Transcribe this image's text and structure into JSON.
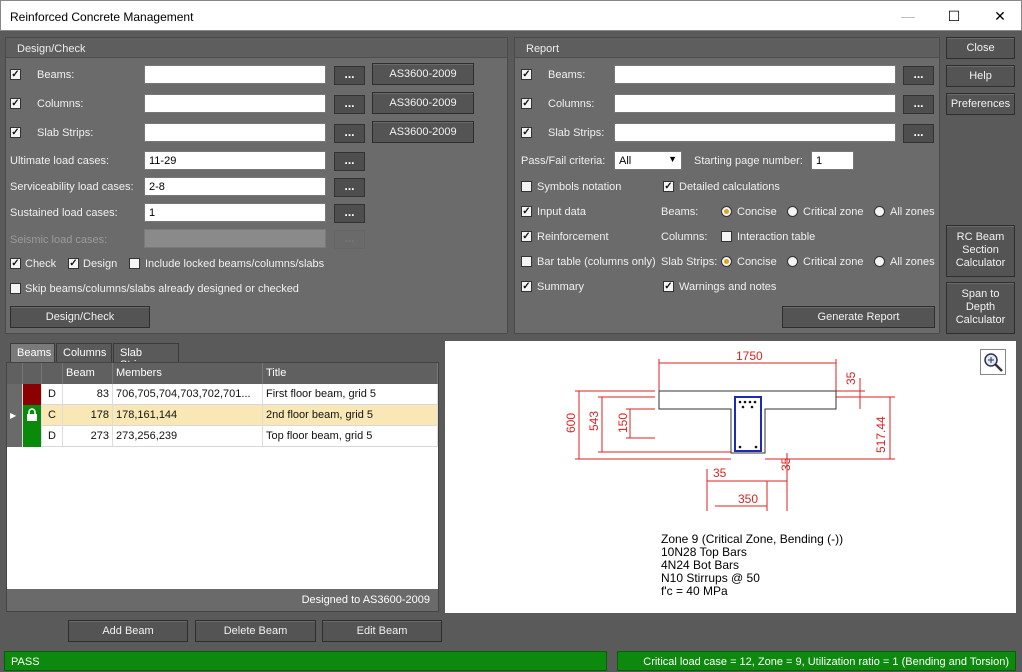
{
  "window": {
    "title": "Reinforced Concrete Management",
    "minimize": "—",
    "maximize": "☐",
    "close": "✕"
  },
  "design": {
    "title": "Design/Check",
    "beams": "Beams:",
    "columns": "Columns:",
    "slabs": "Slab Strips:",
    "code_beams": "AS3600-2009",
    "code_columns": "AS3600-2009",
    "code_slabs": "AS3600-2009",
    "dots": "...",
    "ult_label": "Ultimate load cases:",
    "ult_value": "11-29",
    "svc_label": "Serviceability load cases:",
    "svc_value": "2-8",
    "sus_label": "Sustained load cases:",
    "sus_value": "1",
    "seis_label": "Seismic load cases:",
    "check": "Check",
    "design": "Design",
    "include_locked": "Include locked beams/columns/slabs",
    "skip": "Skip beams/columns/slabs already designed or checked",
    "button": "Design/Check"
  },
  "report": {
    "title": "Report",
    "beams": "Beams:",
    "columns": "Columns:",
    "slabs": "Slab Strips:",
    "passfail_label": "Pass/Fail criteria:",
    "passfail_value": "All",
    "startpage_label": "Starting page number:",
    "startpage_value": "1",
    "symbols": "Symbols notation",
    "detailed": "Detailed calculations",
    "input": "Input data",
    "beams_opt": "Beams:",
    "concise": "Concise",
    "critical": "Critical zone",
    "allzones": "All zones",
    "reinforcement": "Reinforcement",
    "columns_opt": "Columns:",
    "interaction": "Interaction table",
    "bartable": "Bar table (columns only)",
    "slabs_opt": "Slab Strips:",
    "summary": "Summary",
    "warnings": "Warnings and notes",
    "generate": "Generate Report"
  },
  "side": {
    "close": "Close",
    "help": "Help",
    "prefs": "Preferences",
    "rc_calc": [
      "RC Beam",
      "Section",
      "Calculator"
    ],
    "span_calc": [
      "Span to",
      "Depth",
      "Calculator"
    ]
  },
  "tabs": [
    "Beams",
    "Columns",
    "Slab Strips"
  ],
  "table": {
    "headers": [
      "Beam",
      "Members",
      "Title"
    ],
    "rows": [
      {
        "code": "D",
        "beam": "83",
        "members": "706,705,704,703,702,701...",
        "title": "First floor beam, grid 5",
        "color": "#8b0000"
      },
      {
        "code": "C",
        "beam": "178",
        "members": "178,161,144",
        "title": "2nd floor beam, grid 5",
        "color": "#0a8a0a"
      },
      {
        "code": "D",
        "beam": "273",
        "members": "273,256,239",
        "title": "Top floor beam, grid 5",
        "color": "#0a8a0a"
      }
    ],
    "footer": "Designed to AS3600-2009"
  },
  "actions": {
    "add": "Add Beam",
    "delete": "Delete Beam",
    "edit": "Edit Beam"
  },
  "drawing": {
    "dims": {
      "top_width": "1750",
      "flange_thk": "35",
      "overall": "600",
      "web_depth": "543",
      "flange": "150",
      "right_depth": "517.44",
      "cover_left": "35",
      "cover_right": "35",
      "web_width": "350"
    },
    "notes": [
      "Zone 9 (Critical Zone, Bending (-))",
      "10N28 Top Bars",
      "4N24 Bot Bars",
      "N10 Stirrups @ 50",
      "f'c = 40 MPa"
    ]
  },
  "status": {
    "left": "PASS",
    "right": "Critical load case = 12, Zone = 9, Utilization ratio = 1 (Bending and Torsion)"
  }
}
